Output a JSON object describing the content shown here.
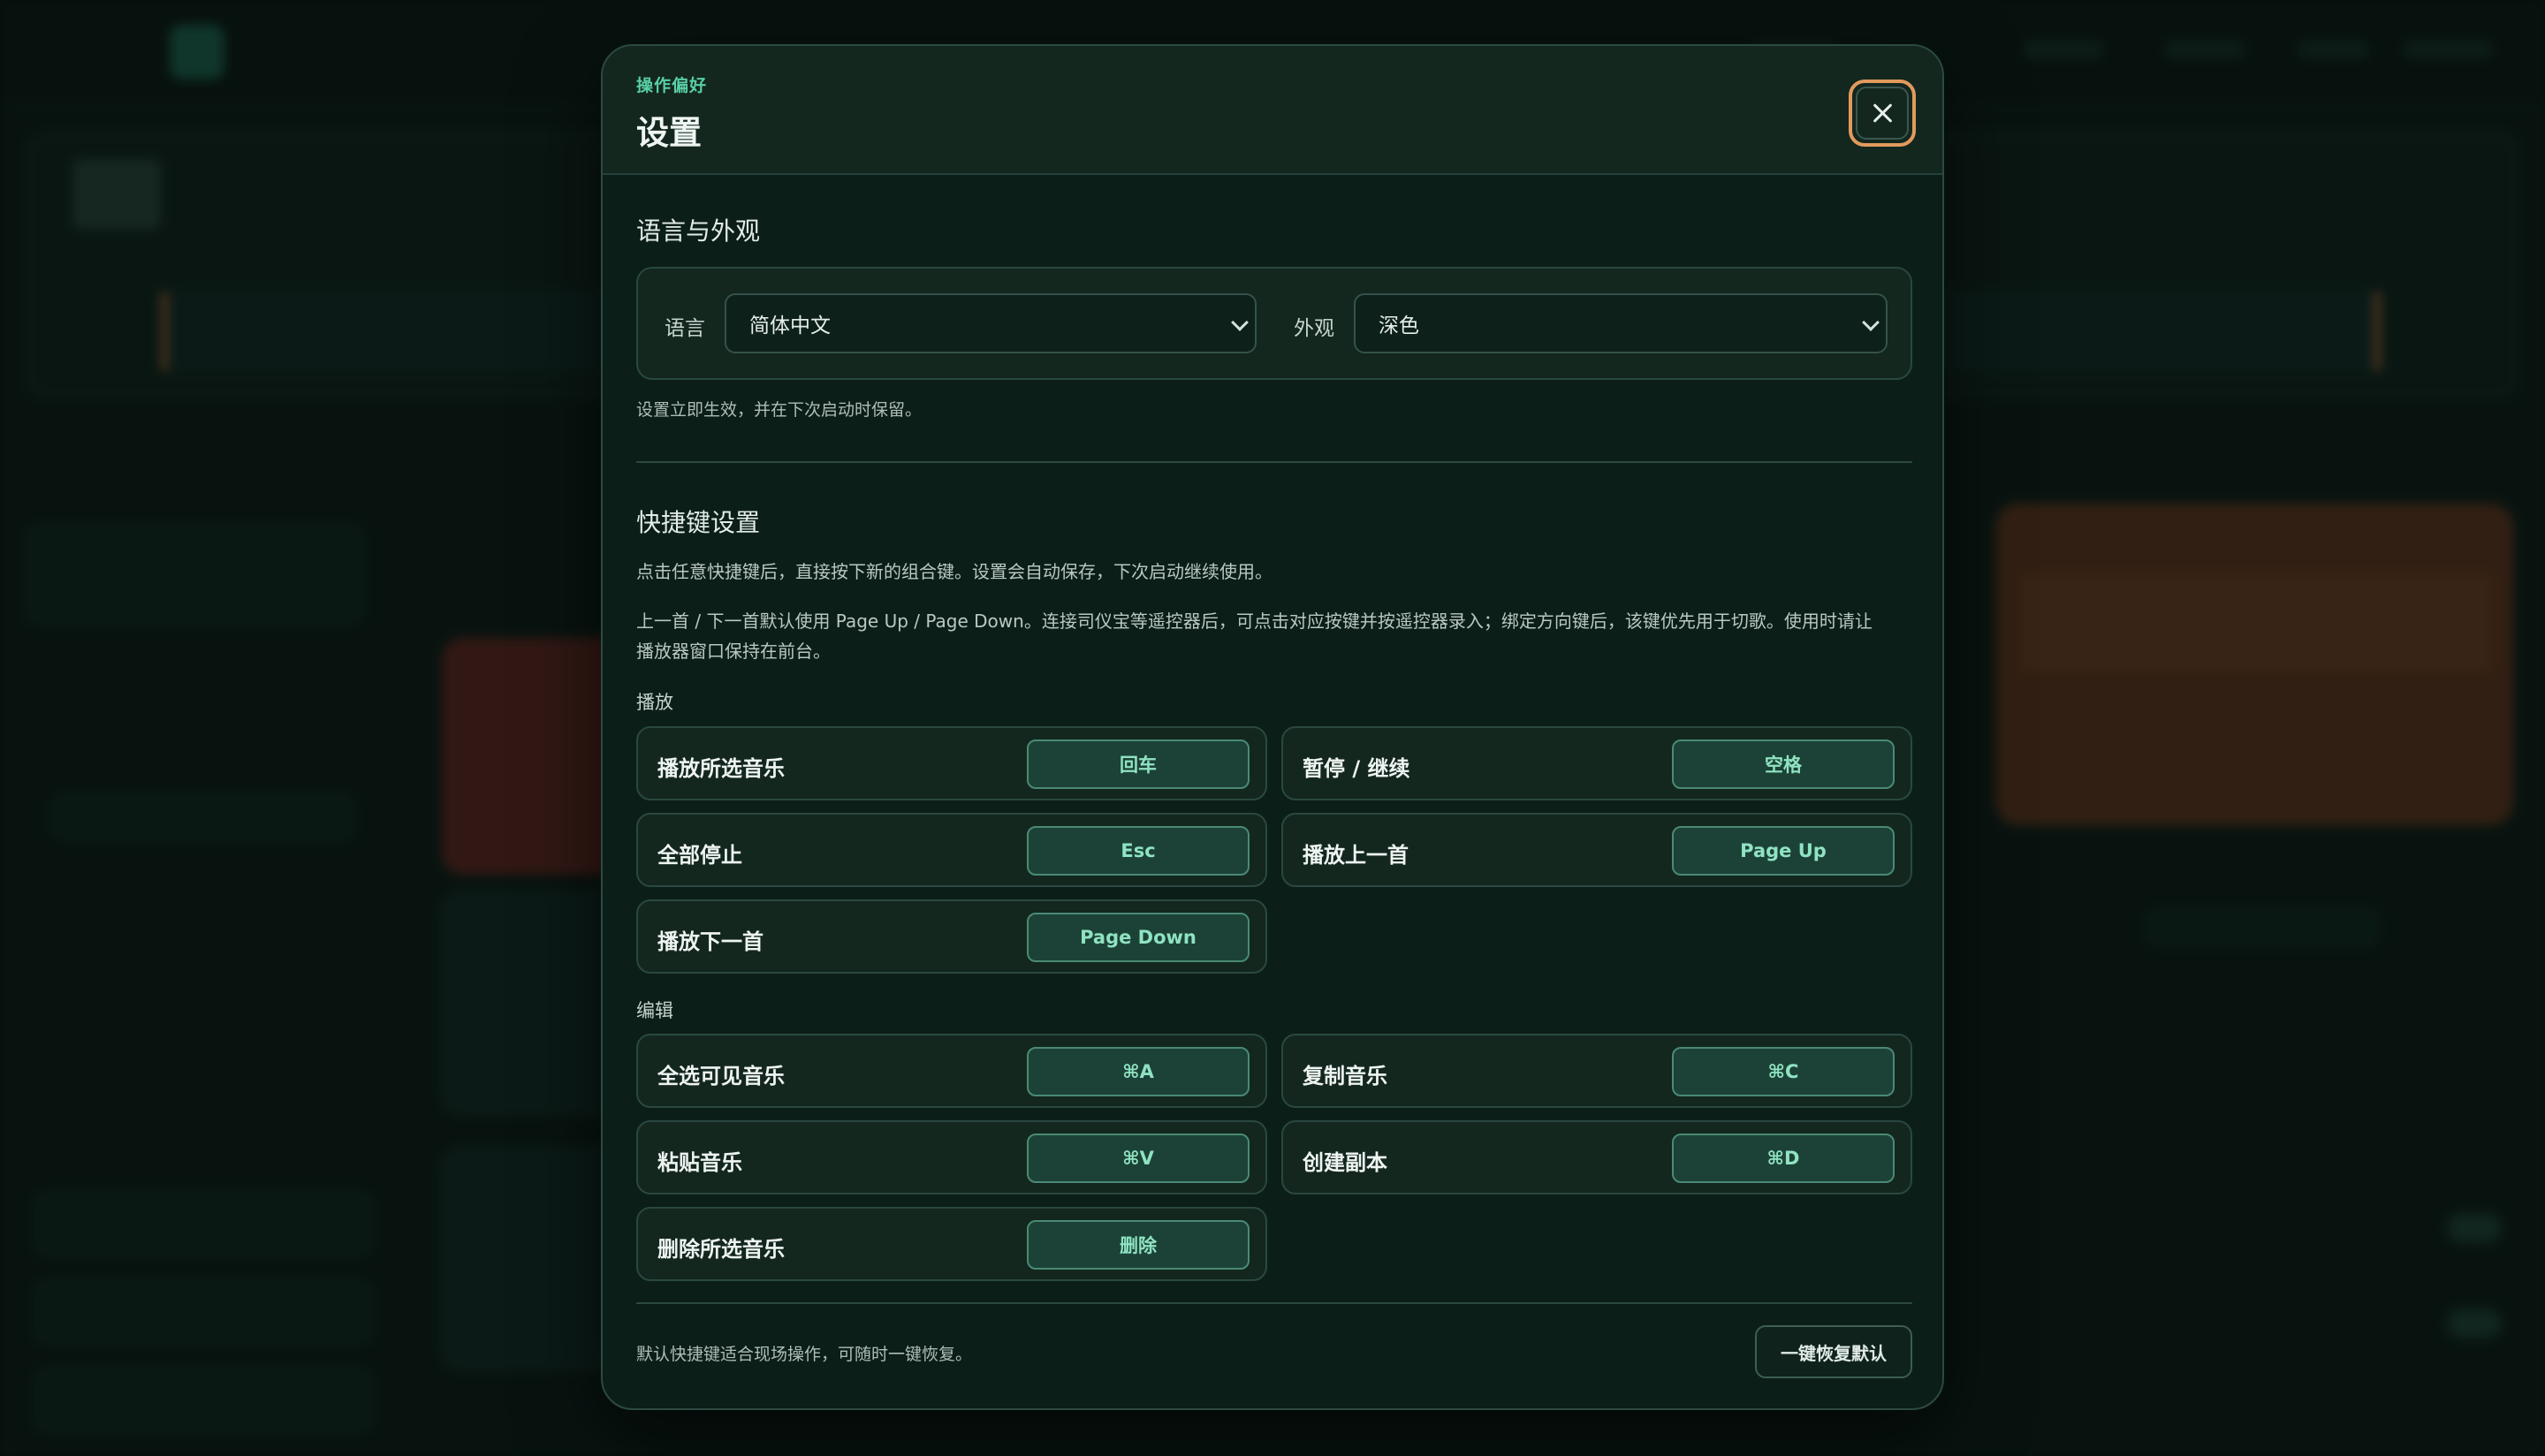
{
  "modal": {
    "eyebrow": "操作偏好",
    "title": "设置"
  },
  "appearance": {
    "section_title": "语言与外观",
    "language_label": "语言",
    "language_value": "简体中文",
    "theme_label": "外观",
    "theme_value": "深色",
    "note": "设置立即生效，并在下次启动时保留。"
  },
  "shortcuts": {
    "section_title": "快捷键设置",
    "hint_1": "点击任意快捷键后，直接按下新的组合键。设置会自动保存，下次启动继续使用。",
    "hint_2_line1": "上一首 / 下一首默认使用 Page Up / Page Down。连接司仪宝等遥控器后，可点击对应按键并按遥控器录入；绑定方向键后，该键优先用于切歌。使用时请让",
    "hint_2_line2": "播放器窗口保持在前台。",
    "playback": {
      "label": "播放",
      "items": [
        {
          "label": "播放所选音乐",
          "key": "回车"
        },
        {
          "label": "暂停 / 继续",
          "key": "空格"
        },
        {
          "label": "全部停止",
          "key": "Esc"
        },
        {
          "label": "播放上一首",
          "key": "Page Up"
        },
        {
          "label": "播放下一首",
          "key": "Page Down"
        }
      ]
    },
    "edit": {
      "label": "编辑",
      "items": [
        {
          "label": "全选可见音乐",
          "key": "⌘A"
        },
        {
          "label": "复制音乐",
          "key": "⌘C"
        },
        {
          "label": "粘贴音乐",
          "key": "⌘V"
        },
        {
          "label": "创建副本",
          "key": "⌘D"
        },
        {
          "label": "删除所选音乐",
          "key": "删除"
        }
      ]
    },
    "footer_note": "默认快捷键适合现场操作，可随时一键恢复。",
    "restore_label": "一键恢复默认"
  },
  "colors": {
    "accent": "#59cfa6",
    "key_text": "#8fe3c2",
    "focus_ring": "#e29a5c",
    "modal_bg": "#0c1e18"
  }
}
